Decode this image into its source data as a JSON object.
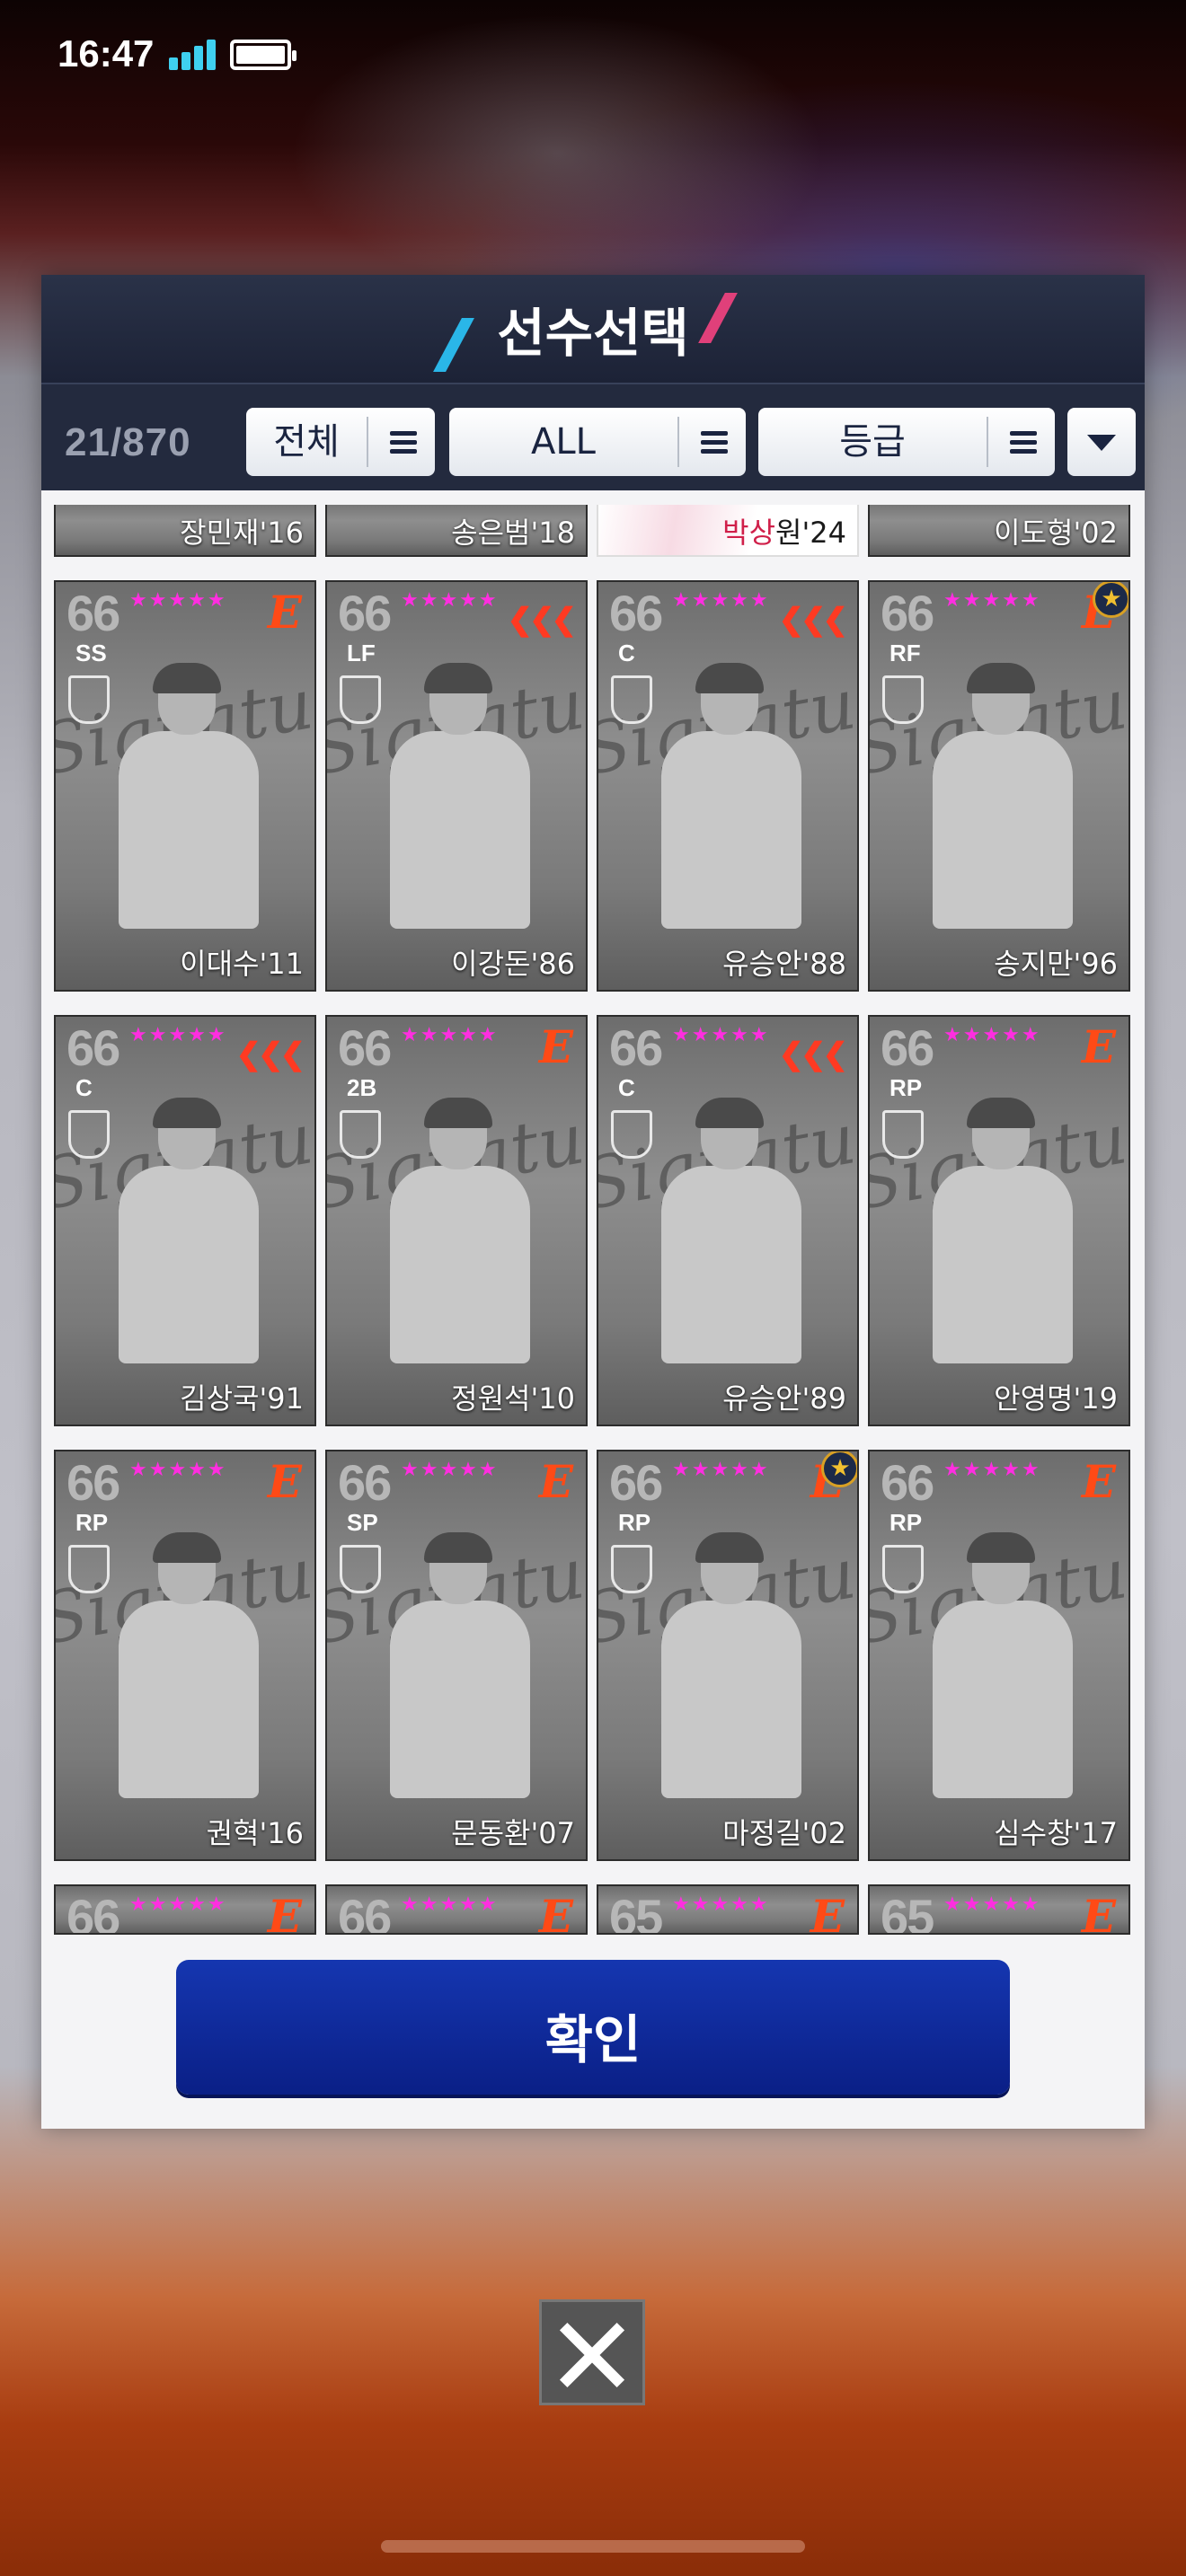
{
  "status": {
    "time": "16:47"
  },
  "panel": {
    "title": "선수선택",
    "count": "21/870",
    "filters": [
      {
        "label": "전체"
      },
      {
        "label": "ALL"
      },
      {
        "label": "등급"
      }
    ],
    "confirm_label": "확인"
  },
  "top_row": [
    {
      "name": "장민재'16"
    },
    {
      "name": "송은범'18"
    },
    {
      "name_hl": "박상",
      "name_rest": "원'24"
    },
    {
      "name": "이도형'02"
    }
  ],
  "cards": [
    {
      "ovr": "66",
      "pos": "SS",
      "name": "이대수'11",
      "logo": "E",
      "badge": false
    },
    {
      "ovr": "66",
      "pos": "LF",
      "name": "이강돈'86",
      "logo": "wing",
      "badge": false
    },
    {
      "ovr": "66",
      "pos": "C",
      "name": "유승안'88",
      "logo": "wing",
      "badge": false
    },
    {
      "ovr": "66",
      "pos": "RF",
      "name": "송지만'96",
      "logo": "E",
      "badge": true
    },
    {
      "ovr": "66",
      "pos": "C",
      "name": "김상국'91",
      "logo": "wing",
      "badge": false
    },
    {
      "ovr": "66",
      "pos": "2B",
      "name": "정원석'10",
      "logo": "E",
      "badge": false
    },
    {
      "ovr": "66",
      "pos": "C",
      "name": "유승안'89",
      "logo": "wing",
      "badge": false
    },
    {
      "ovr": "66",
      "pos": "RP",
      "name": "안영명'19",
      "logo": "E",
      "badge": false
    },
    {
      "ovr": "66",
      "pos": "RP",
      "name": "권혁'16",
      "logo": "E",
      "badge": false
    },
    {
      "ovr": "66",
      "pos": "SP",
      "name": "문동환'07",
      "logo": "E",
      "badge": false
    },
    {
      "ovr": "66",
      "pos": "RP",
      "name": "마정길'02",
      "logo": "E",
      "badge": true
    },
    {
      "ovr": "66",
      "pos": "RP",
      "name": "심수창'17",
      "logo": "E",
      "badge": false
    }
  ],
  "bottom_row": [
    {
      "ovr": "66"
    },
    {
      "ovr": "66"
    },
    {
      "ovr": "65"
    },
    {
      "ovr": "65"
    }
  ],
  "card_stars": "★★★★★",
  "card_sig": "Signature",
  "colors": {
    "header_bg": "#232a3e",
    "accent_blue": "#2ab6e8",
    "accent_pink": "#e0407a",
    "star_color": "#ff2ee0",
    "logo_orange": "#ff4a16",
    "confirm_bg": "#0a1f86"
  },
  "icons": {
    "menu": "hamburger-icon",
    "dropdown": "triangle-down-icon",
    "badge": "star-badge-icon",
    "close": "close-x-icon"
  }
}
